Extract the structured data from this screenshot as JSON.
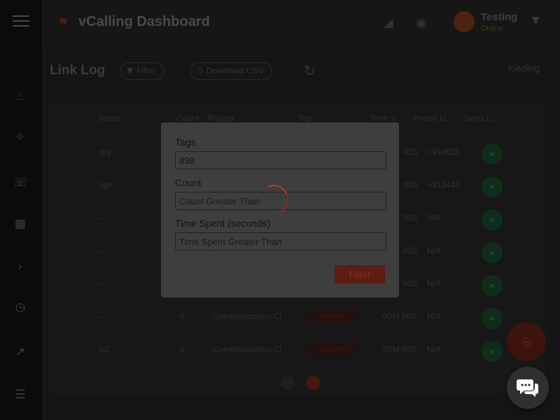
{
  "app": {
    "title": "vCalling Dashboard",
    "user_name": "Testing",
    "user_status": "Online",
    "brand_icon": "flag-icon"
  },
  "sidebar": {
    "icons": [
      "flame-icon",
      "wand-icon",
      "phone-icon",
      "grid-icon",
      "arrow-icon",
      "clock-icon",
      "trend-icon",
      "list-icon"
    ]
  },
  "page": {
    "title": "Link Log",
    "filter_label": "Filter",
    "download_label": "Download CSV",
    "loading_text": "loading"
  },
  "table": {
    "headers": [
      "Name",
      "Count",
      "Project",
      "Tag",
      "Time S...",
      "Phone N...",
      "Send L..."
    ],
    "rows": [
      {
        "name": "drg",
        "count": "",
        "project": "",
        "tag": "",
        "time": "00S",
        "phone": "+919625"
      },
      {
        "name": "ngv",
        "count": "",
        "project": "",
        "tag": "",
        "time": "00S",
        "phone": "+913447"
      },
      {
        "name": "--",
        "count": "",
        "project": "",
        "tag": "",
        "time": "00S",
        "phone": "N/A"
      },
      {
        "name": "--",
        "count": "",
        "project": "",
        "tag": "",
        "time": "00S",
        "phone": "N/A"
      },
      {
        "name": "--",
        "count": "",
        "project": "",
        "tag": "",
        "time": "00S",
        "phone": "N/A"
      },
      {
        "name": "--",
        "count": "0",
        "project": "Communication Cl",
        "tag": "Industry",
        "time": "00M 00S",
        "phone": "N/A"
      },
      {
        "name": "ls2",
        "count": "0",
        "project": "Communication Cl",
        "tag": "Industry",
        "time": "00M 00S",
        "phone": "N/A"
      }
    ]
  },
  "modal": {
    "tags_label": "Tags",
    "tags_value": "898",
    "count_label": "Count",
    "count_placeholder": "Count Greater Than",
    "time_label": "Time Spent (seconds)",
    "time_placeholder": "Time Spent Greater Than",
    "filter_button": "Filter"
  },
  "colors": {
    "accent": "#c0392b",
    "send_green": "#1f5a36"
  }
}
